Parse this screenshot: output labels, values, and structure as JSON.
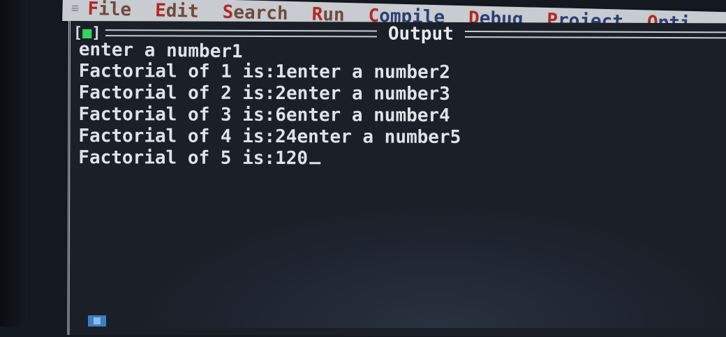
{
  "menubar": {
    "system_icon": "≡",
    "items": [
      {
        "hot": "F",
        "rest": "ile"
      },
      {
        "hot": "E",
        "rest": "dit"
      },
      {
        "hot": "S",
        "rest": "earch"
      },
      {
        "hot": "R",
        "rest": "un"
      },
      {
        "hot": "C",
        "rest": "ompile"
      },
      {
        "hot": "D",
        "rest": "ebug"
      },
      {
        "hot": "P",
        "rest": "roject"
      },
      {
        "hot": "O",
        "rest": "pti"
      }
    ]
  },
  "window": {
    "close_left": "[",
    "close_mark": "■",
    "close_right": "]",
    "title": "Output"
  },
  "output": {
    "lines": [
      "enter a number1",
      "Factorial of 1 is:1enter a number2",
      "Factorial of 2 is:2enter a number3",
      "Factorial of 3 is:6enter a number4",
      "Factorial of 4 is:24enter a number5",
      "Factorial of 5 is:120"
    ]
  }
}
